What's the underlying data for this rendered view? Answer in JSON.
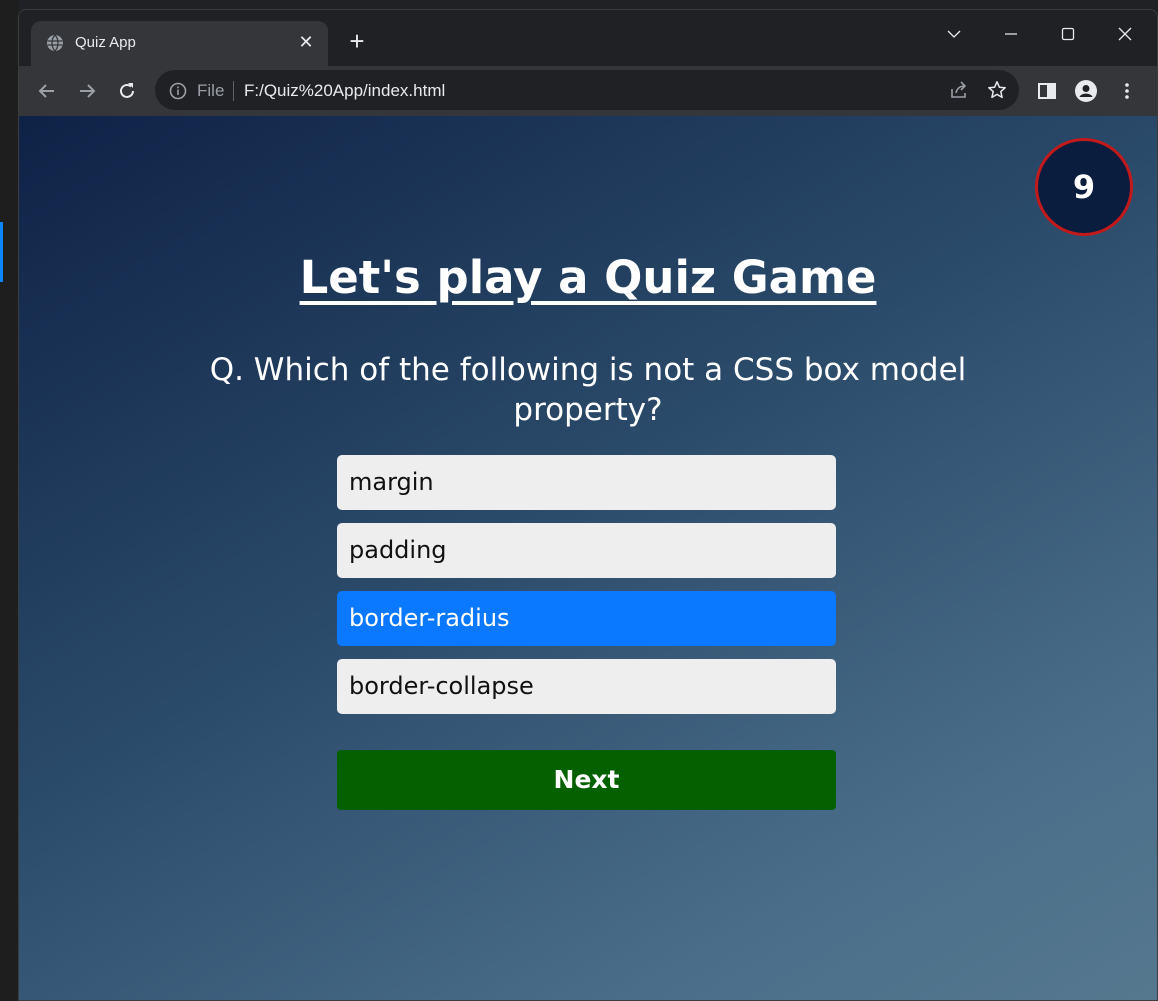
{
  "browser": {
    "tab_title": "Quiz App",
    "tab_close": "✕",
    "new_tab": "+",
    "url_scheme": "File",
    "url": "F:/Quiz%20App/index.html"
  },
  "icons": {
    "tab": "globe-icon",
    "back": "back-arrow-icon",
    "forward": "forward-arrow-icon",
    "reload": "reload-icon",
    "info": "info-icon",
    "share": "share-icon",
    "bookmark": "star-icon",
    "side_panel": "side-panel-icon",
    "profile": "profile-icon",
    "menu": "kebab-menu-icon",
    "window": [
      "chevron-down-icon",
      "minimize-icon",
      "maximize-icon",
      "close-icon"
    ]
  },
  "quiz": {
    "timer": "9",
    "title": "Let's play a Quiz Game",
    "question": "Q. Which of the following is not a CSS box model property?",
    "options": [
      {
        "label": "margin",
        "selected": false
      },
      {
        "label": "padding",
        "selected": false
      },
      {
        "label": "border-radius",
        "selected": true
      },
      {
        "label": "border-collapse",
        "selected": false
      }
    ],
    "next_label": "Next"
  },
  "colors": {
    "timer_border": "#c21a1a",
    "selected_option": "#0a78ff",
    "next_button": "#056000",
    "option_bg": "#eeeeef"
  }
}
